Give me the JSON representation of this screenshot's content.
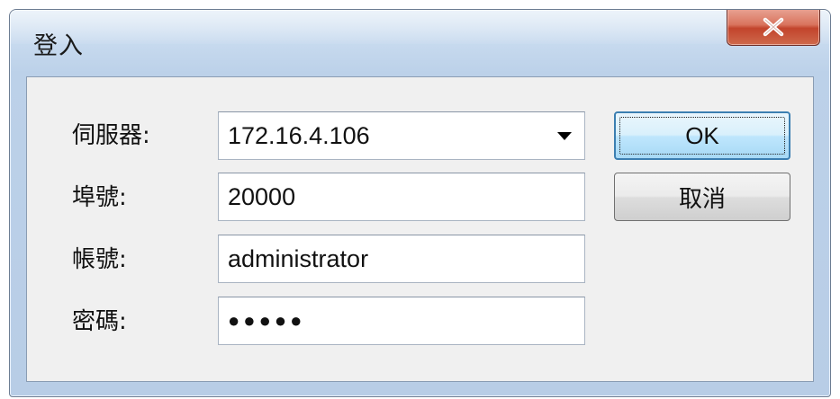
{
  "window": {
    "title": "登入"
  },
  "form": {
    "server": {
      "label": "伺服器:",
      "value": "172.16.4.106"
    },
    "port": {
      "label": "埠號:",
      "value": "20000"
    },
    "account": {
      "label": "帳號:",
      "value": "administrator"
    },
    "password": {
      "label": "密碼:",
      "masked_value": "●●●●●"
    }
  },
  "buttons": {
    "ok_label": "OK",
    "cancel_label": "取消"
  },
  "icons": {
    "close": "close-icon",
    "dropdown": "chevron-down-icon"
  },
  "colors": {
    "close_button": "#c2442c",
    "default_button_border": "#3c7fb1",
    "frame": "#bcd1e9"
  }
}
